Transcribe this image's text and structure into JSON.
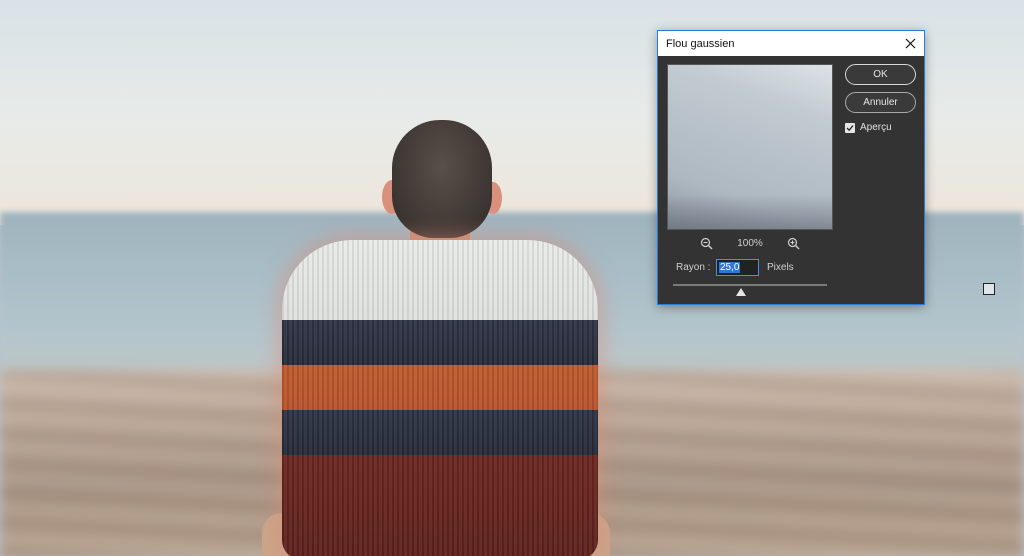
{
  "dialog": {
    "title": "Flou gaussien",
    "ok_label": "OK",
    "cancel_label": "Annuler",
    "preview_label": "Aperçu",
    "preview_checked": true,
    "zoom_level": "100%",
    "radius_label": "Rayon :",
    "radius_value": "25,0",
    "radius_unit": "Pixels",
    "slider_fraction": 0.44
  },
  "icons": {
    "close": "close-icon",
    "zoom_out": "zoom-out-icon",
    "zoom_in": "zoom-in-icon",
    "check": "checkmark-icon"
  }
}
